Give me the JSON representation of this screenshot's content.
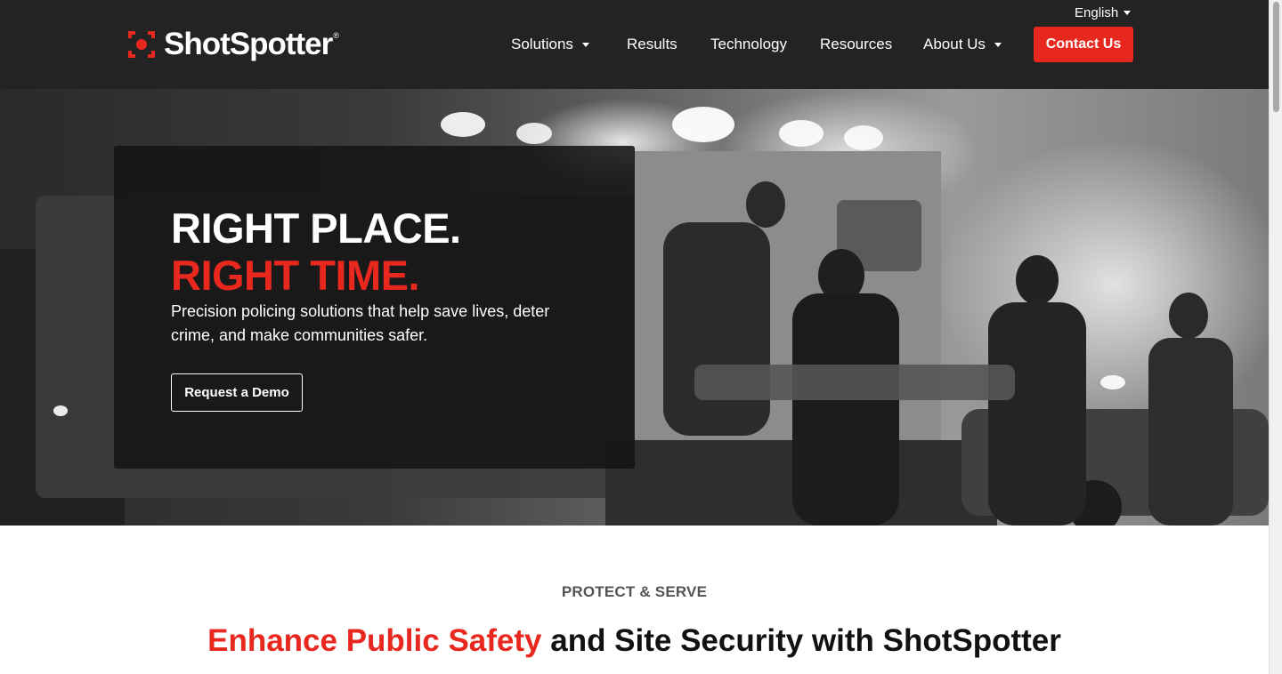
{
  "header": {
    "brand": "ShotSpotter",
    "brand_mark": "®",
    "language": "English",
    "nav": [
      {
        "label": "Solutions",
        "has_dropdown": true
      },
      {
        "label": "Results",
        "has_dropdown": false
      },
      {
        "label": "Technology",
        "has_dropdown": false
      },
      {
        "label": "Resources",
        "has_dropdown": false
      },
      {
        "label": "About Us",
        "has_dropdown": true
      }
    ],
    "contact_label": "Contact Us"
  },
  "hero": {
    "headline_1": "RIGHT PLACE.",
    "headline_2": "RIGHT TIME.",
    "subtitle": "Precision policing solutions that help save lives, deter crime, and make communities safer.",
    "cta_label": "Request a Demo"
  },
  "section": {
    "eyebrow": "PROTECT & SERVE",
    "title_red": "Enhance Public Safety",
    "title_rest": " and Site Security with ShotSpotter"
  },
  "colors": {
    "accent": "#e8281f",
    "header_bg": "#232323"
  }
}
